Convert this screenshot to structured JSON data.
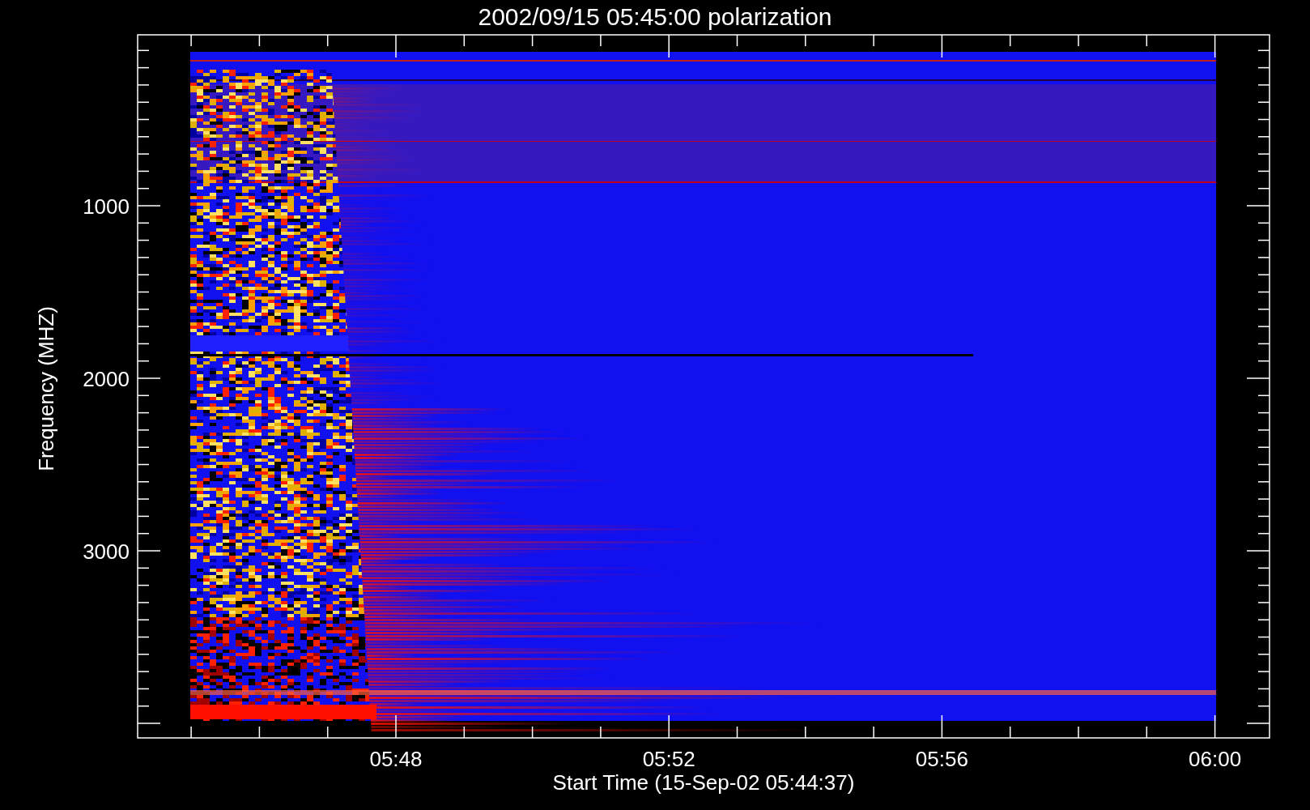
{
  "plot": {
    "title": "2002/09/15 05:45:00 polarization",
    "ylabel": "Frequency (MHZ)",
    "xlabel": "Start Time (15-Sep-02 05:44:37)",
    "yticks": [
      "1000",
      "2000",
      "3000"
    ],
    "xticks": [
      "05:48",
      "05:52",
      "05:56",
      "06:00"
    ]
  }
}
